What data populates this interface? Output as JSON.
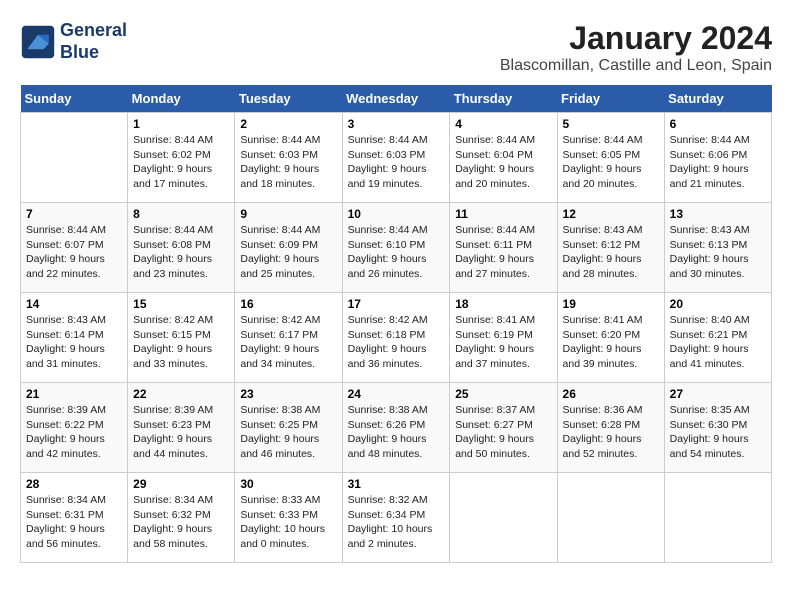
{
  "header": {
    "logo_line1": "General",
    "logo_line2": "Blue",
    "month": "January 2024",
    "location": "Blascomillan, Castille and Leon, Spain"
  },
  "weekdays": [
    "Sunday",
    "Monday",
    "Tuesday",
    "Wednesday",
    "Thursday",
    "Friday",
    "Saturday"
  ],
  "weeks": [
    [
      {
        "day": "",
        "sunrise": "",
        "sunset": "",
        "daylight": ""
      },
      {
        "day": "1",
        "sunrise": "Sunrise: 8:44 AM",
        "sunset": "Sunset: 6:02 PM",
        "daylight": "Daylight: 9 hours and 17 minutes."
      },
      {
        "day": "2",
        "sunrise": "Sunrise: 8:44 AM",
        "sunset": "Sunset: 6:03 PM",
        "daylight": "Daylight: 9 hours and 18 minutes."
      },
      {
        "day": "3",
        "sunrise": "Sunrise: 8:44 AM",
        "sunset": "Sunset: 6:03 PM",
        "daylight": "Daylight: 9 hours and 19 minutes."
      },
      {
        "day": "4",
        "sunrise": "Sunrise: 8:44 AM",
        "sunset": "Sunset: 6:04 PM",
        "daylight": "Daylight: 9 hours and 20 minutes."
      },
      {
        "day": "5",
        "sunrise": "Sunrise: 8:44 AM",
        "sunset": "Sunset: 6:05 PM",
        "daylight": "Daylight: 9 hours and 20 minutes."
      },
      {
        "day": "6",
        "sunrise": "Sunrise: 8:44 AM",
        "sunset": "Sunset: 6:06 PM",
        "daylight": "Daylight: 9 hours and 21 minutes."
      }
    ],
    [
      {
        "day": "7",
        "sunrise": "Sunrise: 8:44 AM",
        "sunset": "Sunset: 6:07 PM",
        "daylight": "Daylight: 9 hours and 22 minutes."
      },
      {
        "day": "8",
        "sunrise": "Sunrise: 8:44 AM",
        "sunset": "Sunset: 6:08 PM",
        "daylight": "Daylight: 9 hours and 23 minutes."
      },
      {
        "day": "9",
        "sunrise": "Sunrise: 8:44 AM",
        "sunset": "Sunset: 6:09 PM",
        "daylight": "Daylight: 9 hours and 25 minutes."
      },
      {
        "day": "10",
        "sunrise": "Sunrise: 8:44 AM",
        "sunset": "Sunset: 6:10 PM",
        "daylight": "Daylight: 9 hours and 26 minutes."
      },
      {
        "day": "11",
        "sunrise": "Sunrise: 8:44 AM",
        "sunset": "Sunset: 6:11 PM",
        "daylight": "Daylight: 9 hours and 27 minutes."
      },
      {
        "day": "12",
        "sunrise": "Sunrise: 8:43 AM",
        "sunset": "Sunset: 6:12 PM",
        "daylight": "Daylight: 9 hours and 28 minutes."
      },
      {
        "day": "13",
        "sunrise": "Sunrise: 8:43 AM",
        "sunset": "Sunset: 6:13 PM",
        "daylight": "Daylight: 9 hours and 30 minutes."
      }
    ],
    [
      {
        "day": "14",
        "sunrise": "Sunrise: 8:43 AM",
        "sunset": "Sunset: 6:14 PM",
        "daylight": "Daylight: 9 hours and 31 minutes."
      },
      {
        "day": "15",
        "sunrise": "Sunrise: 8:42 AM",
        "sunset": "Sunset: 6:15 PM",
        "daylight": "Daylight: 9 hours and 33 minutes."
      },
      {
        "day": "16",
        "sunrise": "Sunrise: 8:42 AM",
        "sunset": "Sunset: 6:17 PM",
        "daylight": "Daylight: 9 hours and 34 minutes."
      },
      {
        "day": "17",
        "sunrise": "Sunrise: 8:42 AM",
        "sunset": "Sunset: 6:18 PM",
        "daylight": "Daylight: 9 hours and 36 minutes."
      },
      {
        "day": "18",
        "sunrise": "Sunrise: 8:41 AM",
        "sunset": "Sunset: 6:19 PM",
        "daylight": "Daylight: 9 hours and 37 minutes."
      },
      {
        "day": "19",
        "sunrise": "Sunrise: 8:41 AM",
        "sunset": "Sunset: 6:20 PM",
        "daylight": "Daylight: 9 hours and 39 minutes."
      },
      {
        "day": "20",
        "sunrise": "Sunrise: 8:40 AM",
        "sunset": "Sunset: 6:21 PM",
        "daylight": "Daylight: 9 hours and 41 minutes."
      }
    ],
    [
      {
        "day": "21",
        "sunrise": "Sunrise: 8:39 AM",
        "sunset": "Sunset: 6:22 PM",
        "daylight": "Daylight: 9 hours and 42 minutes."
      },
      {
        "day": "22",
        "sunrise": "Sunrise: 8:39 AM",
        "sunset": "Sunset: 6:23 PM",
        "daylight": "Daylight: 9 hours and 44 minutes."
      },
      {
        "day": "23",
        "sunrise": "Sunrise: 8:38 AM",
        "sunset": "Sunset: 6:25 PM",
        "daylight": "Daylight: 9 hours and 46 minutes."
      },
      {
        "day": "24",
        "sunrise": "Sunrise: 8:38 AM",
        "sunset": "Sunset: 6:26 PM",
        "daylight": "Daylight: 9 hours and 48 minutes."
      },
      {
        "day": "25",
        "sunrise": "Sunrise: 8:37 AM",
        "sunset": "Sunset: 6:27 PM",
        "daylight": "Daylight: 9 hours and 50 minutes."
      },
      {
        "day": "26",
        "sunrise": "Sunrise: 8:36 AM",
        "sunset": "Sunset: 6:28 PM",
        "daylight": "Daylight: 9 hours and 52 minutes."
      },
      {
        "day": "27",
        "sunrise": "Sunrise: 8:35 AM",
        "sunset": "Sunset: 6:30 PM",
        "daylight": "Daylight: 9 hours and 54 minutes."
      }
    ],
    [
      {
        "day": "28",
        "sunrise": "Sunrise: 8:34 AM",
        "sunset": "Sunset: 6:31 PM",
        "daylight": "Daylight: 9 hours and 56 minutes."
      },
      {
        "day": "29",
        "sunrise": "Sunrise: 8:34 AM",
        "sunset": "Sunset: 6:32 PM",
        "daylight": "Daylight: 9 hours and 58 minutes."
      },
      {
        "day": "30",
        "sunrise": "Sunrise: 8:33 AM",
        "sunset": "Sunset: 6:33 PM",
        "daylight": "Daylight: 10 hours and 0 minutes."
      },
      {
        "day": "31",
        "sunrise": "Sunrise: 8:32 AM",
        "sunset": "Sunset: 6:34 PM",
        "daylight": "Daylight: 10 hours and 2 minutes."
      },
      {
        "day": "",
        "sunrise": "",
        "sunset": "",
        "daylight": ""
      },
      {
        "day": "",
        "sunrise": "",
        "sunset": "",
        "daylight": ""
      },
      {
        "day": "",
        "sunrise": "",
        "sunset": "",
        "daylight": ""
      }
    ]
  ]
}
